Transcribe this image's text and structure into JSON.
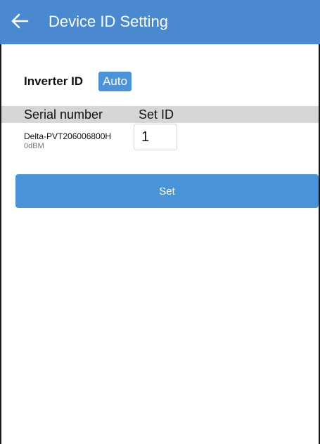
{
  "header": {
    "title": "Device ID Setting",
    "back_icon": "arrow-left-icon",
    "background_color": "#4a89cf"
  },
  "inverter": {
    "label": "Inverter ID",
    "auto_label": "Auto"
  },
  "table": {
    "columns": [
      "Serial number",
      "Set ID"
    ],
    "rows": [
      {
        "serial": "Delta-PVT206006800H",
        "signal": "0dBM",
        "set_id": "1"
      }
    ]
  },
  "actions": {
    "set_label": "Set",
    "accent_color": "#4a93d6"
  }
}
